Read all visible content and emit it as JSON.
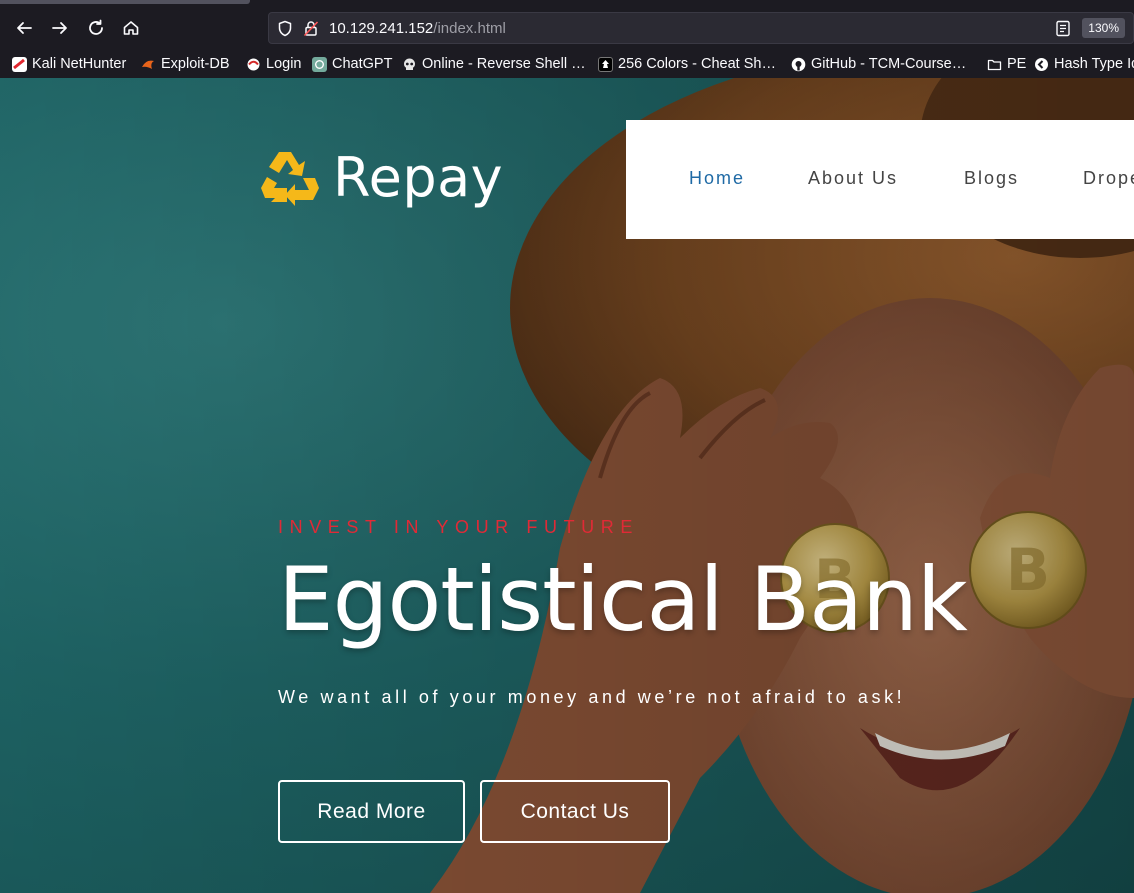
{
  "browser": {
    "url_host": "10.129.241.152",
    "url_path": "/index.html",
    "zoom": "130%",
    "bookmarks": [
      {
        "label": "Kali NetHunter",
        "icon": "kali-icon"
      },
      {
        "label": "Exploit-DB",
        "icon": "exploit-db-icon"
      },
      {
        "label": "Login",
        "icon": "login-icon"
      },
      {
        "label": "ChatGPT",
        "icon": "chatgpt-icon"
      },
      {
        "label": "Online - Reverse Shell …",
        "icon": "skull-icon"
      },
      {
        "label": "256 Colors - Cheat Sh…",
        "icon": "terminal-icon"
      },
      {
        "label": "GitHub - TCM-Course…",
        "icon": "github-icon"
      },
      {
        "label": "PE",
        "icon": "folder-icon"
      },
      {
        "label": "Hash Type Id",
        "icon": "hash-icon"
      }
    ]
  },
  "site": {
    "logo_text": "Repay",
    "nav": [
      "Home",
      "About Us",
      "Blogs",
      "Drope"
    ],
    "active_nav": "Home",
    "hero": {
      "kicker": "INVEST IN YOUR FUTURE",
      "title": "Egotistical Bank",
      "tagline": "We want all of your money and we’re not afraid to ask!",
      "buttons": [
        "Read More",
        "Contact Us"
      ]
    }
  },
  "colors": {
    "accent_red": "#e02a36",
    "nav_active": "#1f6aa5",
    "logo_yellow": "#f5b819",
    "hero_teal": "#1f6667"
  }
}
